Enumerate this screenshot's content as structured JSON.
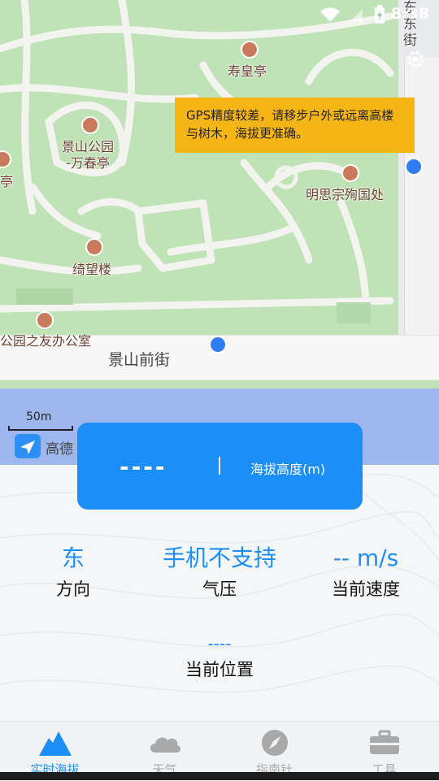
{
  "status_bar": {
    "time": "8:38"
  },
  "map": {
    "pois": [
      {
        "name": "寿皇亭"
      },
      {
        "name": "景山公园\n-万春亭"
      },
      {
        "name": "亭"
      },
      {
        "name": "明思宗殉国处"
      },
      {
        "name": "绮望楼"
      },
      {
        "name": "公园之友办公室"
      }
    ],
    "road_name": "景山前街",
    "street_vertical": "东\n东\n街",
    "scale": "50m",
    "brand": "高德"
  },
  "toast": {
    "text": "GPS精度较差，请移步户外或远离高楼与树木，海拔更准确。"
  },
  "altitude": {
    "value": "----",
    "label": "海拔高度(m)"
  },
  "stats": {
    "direction": {
      "value": "东",
      "label": "方向"
    },
    "pressure": {
      "value": "手机不支持",
      "label": "气压"
    },
    "speed": {
      "value": "-- m/s",
      "label": "当前速度"
    }
  },
  "position": {
    "value": "----",
    "label": "当前位置"
  },
  "tabs": [
    {
      "label": "实时海拔",
      "icon": "mountain-icon"
    },
    {
      "label": "天气",
      "icon": "cloud-icon"
    },
    {
      "label": "指南针",
      "icon": "compass-icon"
    },
    {
      "label": "工具",
      "icon": "toolbox-icon"
    }
  ]
}
